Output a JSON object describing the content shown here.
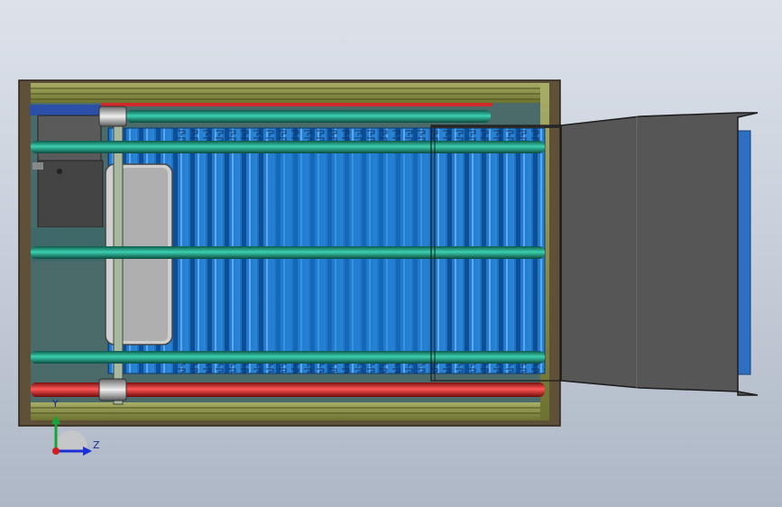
{
  "viewport": {
    "background_top": "#dde2ea",
    "background_bottom": "#aeb7c6"
  },
  "model": {
    "frame_color": "#6b5a3f",
    "rail_color": "#8a8f47",
    "belt_color": "#1f78c8",
    "belt_slat_color": "#0d4f96",
    "green_roller_color": "#1f9c84",
    "red_roller_color": "#d62f2f",
    "motor_color": "#4d4d4d",
    "hopper_color": "#565656",
    "sprocket_count": 2
  },
  "triad": {
    "y_label": "Y",
    "z_label": "Z",
    "y_axis_color": "#1aa33a",
    "z_axis_color": "#1a2fd6",
    "origin_color": "#d02020"
  }
}
